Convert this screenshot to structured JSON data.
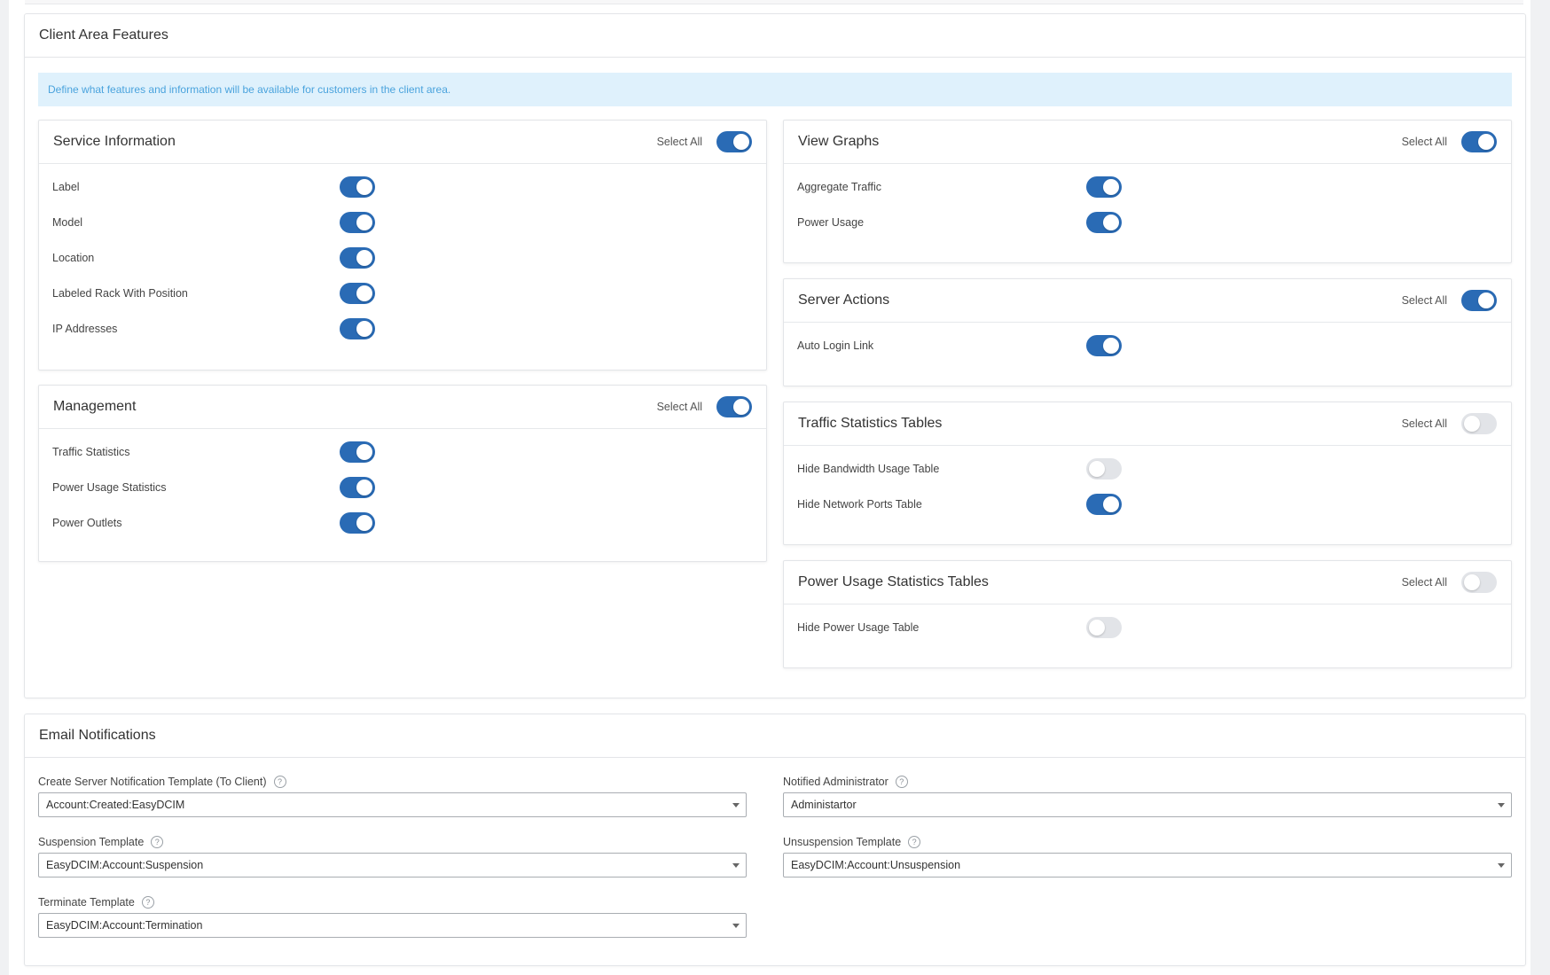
{
  "client_area": {
    "title": "Client Area Features",
    "info": "Define what features and information will be available for customers in the client area.",
    "select_all_label": "Select All",
    "service_information": {
      "title": "Service Information",
      "select_all": true,
      "items": [
        {
          "label": "Label",
          "enabled": true
        },
        {
          "label": "Model",
          "enabled": true
        },
        {
          "label": "Location",
          "enabled": true
        },
        {
          "label": "Labeled Rack With Position",
          "enabled": true
        },
        {
          "label": "IP Addresses",
          "enabled": true
        }
      ]
    },
    "management": {
      "title": "Management",
      "select_all": true,
      "items": [
        {
          "label": "Traffic Statistics",
          "enabled": true
        },
        {
          "label": "Power Usage Statistics",
          "enabled": true
        },
        {
          "label": "Power Outlets",
          "enabled": true
        }
      ]
    },
    "view_graphs": {
      "title": "View Graphs",
      "select_all": true,
      "items": [
        {
          "label": "Aggregate Traffic",
          "enabled": true
        },
        {
          "label": "Power Usage",
          "enabled": true
        }
      ]
    },
    "server_actions": {
      "title": "Server Actions",
      "select_all": true,
      "items": [
        {
          "label": "Auto Login Link",
          "enabled": true
        }
      ]
    },
    "traffic_tables": {
      "title": "Traffic Statistics Tables",
      "select_all": false,
      "items": [
        {
          "label": "Hide Bandwidth Usage Table",
          "enabled": false
        },
        {
          "label": "Hide Network Ports Table",
          "enabled": true
        }
      ]
    },
    "power_tables": {
      "title": "Power Usage Statistics Tables",
      "select_all": false,
      "items": [
        {
          "label": "Hide Power Usage Table",
          "enabled": false
        }
      ]
    }
  },
  "email": {
    "title": "Email Notifications",
    "fields": {
      "create_template": {
        "label": "Create Server Notification Template (To Client)",
        "value": "Account:Created:EasyDCIM"
      },
      "notified_admin": {
        "label": "Notified Administrator",
        "value": "Administartor"
      },
      "suspension": {
        "label": "Suspension Template",
        "value": "EasyDCIM:Account:Suspension"
      },
      "unsuspension": {
        "label": "Unsuspension Template",
        "value": "EasyDCIM:Account:Unsuspension"
      },
      "terminate": {
        "label": "Terminate Template",
        "value": "EasyDCIM:Account:Termination"
      }
    }
  },
  "icons": {
    "help": "help-circle-icon",
    "caret": "caret-down-icon"
  },
  "colors": {
    "toggle_on": "#2a6bb5",
    "toggle_off": "#e2e4e8",
    "info_bg": "#dff1fc",
    "info_text": "#4aa3dd"
  }
}
